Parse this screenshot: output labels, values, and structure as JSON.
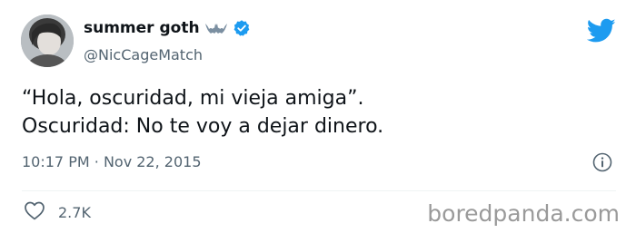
{
  "user": {
    "display_name": "summer goth",
    "handle": "@NicCageMatch",
    "name_badges": [
      "bat-icon",
      "verified-badge-icon"
    ]
  },
  "tweet": {
    "lines": [
      "“Hola, oscuridad, mi vieja amiga”.",
      "Oscuridad: No te voy a dejar dinero."
    ],
    "time": "10:17 PM",
    "separator": "·",
    "date": "Nov 22, 2015"
  },
  "engagement": {
    "like_count": "2.7K",
    "like_icon": "heart-icon"
  },
  "watermark": "boredpanda.com",
  "colors": {
    "twitter_blue": "#1d9bf0",
    "secondary_text": "#536471",
    "primary_text": "#0f1419",
    "watermark": "#9a9a9a"
  }
}
